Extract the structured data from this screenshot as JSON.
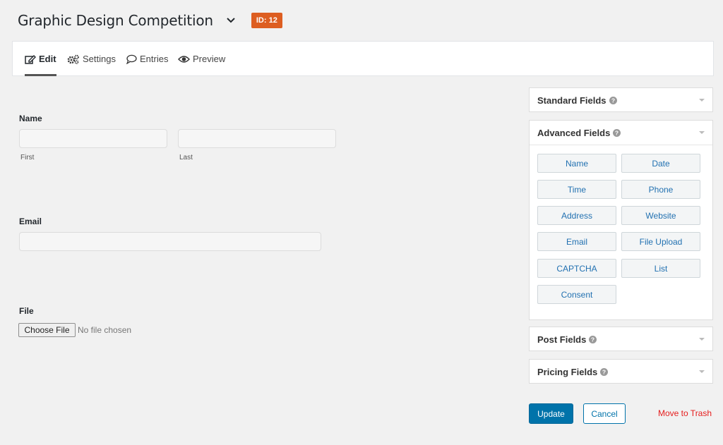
{
  "header": {
    "title": "Graphic Design Competition",
    "id_badge": "ID: 12"
  },
  "tabs": [
    {
      "label": "Edit",
      "icon": "edit-icon",
      "active": true
    },
    {
      "label": "Settings",
      "icon": "gears-icon"
    },
    {
      "label": "Entries",
      "icon": "comment-icon"
    },
    {
      "label": "Preview",
      "icon": "eye-icon"
    }
  ],
  "form": {
    "name": {
      "label": "Name",
      "first": "First",
      "last": "Last",
      "first_value": "",
      "last_value": ""
    },
    "email": {
      "label": "Email",
      "value": ""
    },
    "file": {
      "label": "File",
      "button": "Choose File",
      "status": "No file chosen"
    }
  },
  "panels": {
    "standard": {
      "title": "Standard Fields"
    },
    "advanced": {
      "title": "Advanced Fields",
      "buttons": [
        "Name",
        "Date",
        "Time",
        "Phone",
        "Address",
        "Website",
        "Email",
        "File Upload",
        "CAPTCHA",
        "List",
        "Consent"
      ]
    },
    "post": {
      "title": "Post Fields"
    },
    "pricing": {
      "title": "Pricing Fields"
    }
  },
  "actions": {
    "update": "Update",
    "cancel": "Cancel",
    "trash": "Move to Trash"
  },
  "colors": {
    "accent": "#0073aa",
    "badge": "#dd5e21",
    "danger": "#e51d1d"
  }
}
